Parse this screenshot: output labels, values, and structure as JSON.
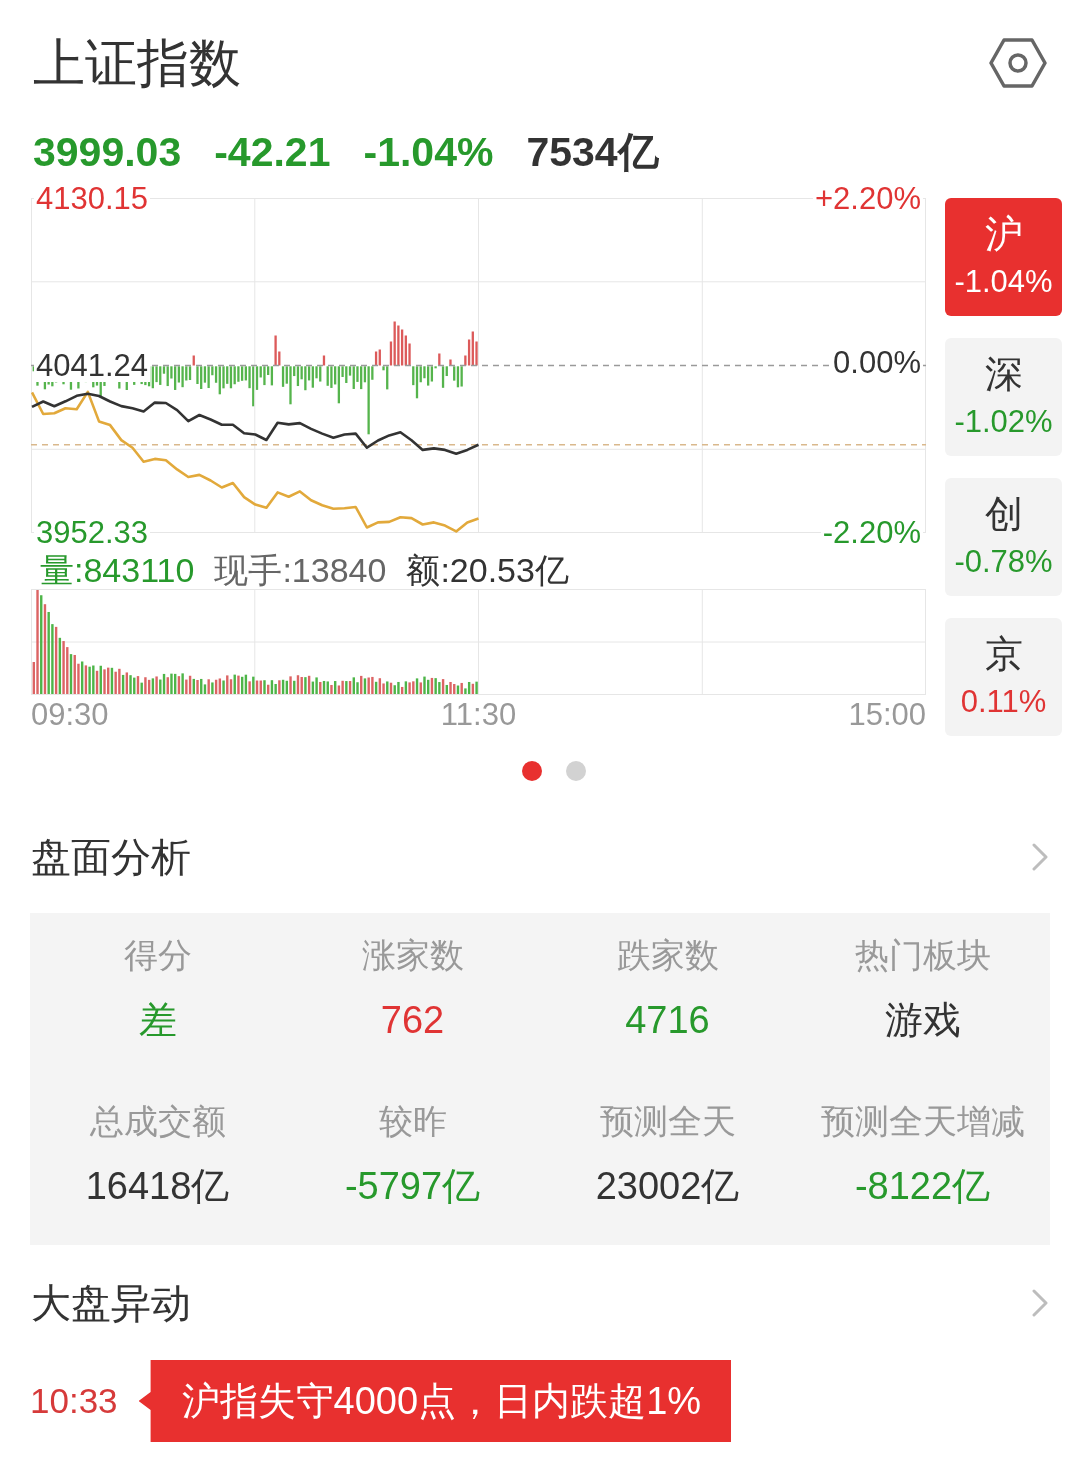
{
  "header": {
    "title": "上证指数"
  },
  "quote": [
    {
      "text": "3999.03",
      "color": "#27992c"
    },
    {
      "text": "-42.21",
      "color": "#27992c"
    },
    {
      "text": "-1.04%",
      "color": "#27992c"
    },
    {
      "text": "7534亿",
      "color": "#333333"
    }
  ],
  "chart": {
    "chart_data": {
      "type": "line",
      "categories": [
        null,
        null,
        null,
        null,
        null,
        null,
        null,
        null,
        null,
        null,
        null,
        null,
        null,
        null,
        null,
        null,
        null,
        null,
        null,
        null,
        null,
        null,
        null,
        null,
        null,
        null,
        null,
        null,
        null,
        null,
        null,
        null,
        null,
        null,
        null,
        null,
        null,
        null,
        null,
        null,
        null,
        null,
        null,
        null,
        null,
        null,
        null,
        null,
        null,
        null,
        null,
        null,
        null,
        null,
        null,
        null,
        null,
        null,
        null,
        null,
        null,
        null,
        null,
        null,
        null,
        null,
        null,
        null,
        null,
        null,
        null,
        null,
        null,
        null,
        null,
        null,
        null,
        null,
        null,
        null,
        null
      ],
      "ylim": [
        3952.33,
        4130.15
      ],
      "yticks": [
        {
          "value": 4130.15,
          "label": "4130.15"
        },
        {
          "value": 4041.24,
          "label": "4041.24"
        },
        {
          "value": 3952.33,
          "label": "3952.33"
        }
      ],
      "ref_lines": [
        {
          "axis": "y",
          "value": 4041.24,
          "color": "#9a9a9a"
        },
        {
          "axis": "y",
          "value": 3999.03,
          "color": "#d9b88c"
        }
      ],
      "series": [
        {
          "color": "#333333",
          "values": [
            4019.2,
            4022.1,
            4019.5,
            4022.2,
            4025.1,
            4026.2,
            4025.0,
            4022.1,
            4019.6,
            4018.5,
            4016.8,
            4021.5,
            4021.3,
            4017.5,
            4011.6,
            4014.9,
            4012.5,
            4009.7,
            4009.7,
            4005.2,
            4004.5,
            4001.6,
            4010.8,
            4009.9,
            4010.6,
            4007.5,
            4005.0,
            4002.8,
            4004.5,
            4005.0,
            3997.5,
            4001.3,
            4004.0,
            4005.7,
            4001.4,
            3996.3,
            3997.1,
            3996.3,
            3994.3,
            3996.3,
            3999.0,
            null,
            null,
            null,
            null,
            null,
            null,
            null,
            null,
            null,
            null,
            null,
            null,
            null,
            null,
            null,
            null,
            null,
            null,
            null,
            null,
            null,
            null,
            null,
            null,
            null,
            null,
            null,
            null,
            null,
            null,
            null,
            null,
            null,
            null,
            null,
            null,
            null,
            null,
            null,
            null
          ]
        },
        {
          "color": "#e2a93b",
          "values": [
            4026.9,
            4015.4,
            4015.8,
            4018.5,
            4018.0,
            4027.2,
            4011.5,
            4009.5,
            4001.5,
            3997.4,
            3990.0,
            3991.5,
            3990.8,
            3985.9,
            3981.9,
            3983.0,
            3980.0,
            3976.3,
            3978.7,
            3971.2,
            3967.2,
            3965.5,
            3973.7,
            3971.4,
            3974.2,
            3969.5,
            3966.8,
            3965.0,
            3965.2,
            3965.9,
            3955.0,
            3957.7,
            3958.0,
            3960.5,
            3960.0,
            3956.6,
            3957.7,
            3956.0,
            3952.9,
            3957.7,
            3959.8,
            null,
            null,
            null,
            null,
            null,
            null,
            null,
            null,
            null,
            null,
            null,
            null,
            null,
            null,
            null,
            null,
            null,
            null,
            null,
            null,
            null,
            null,
            null,
            null,
            null,
            null,
            null,
            null,
            null,
            null,
            null,
            null,
            null,
            null,
            null,
            null,
            null,
            null,
            null,
            null
          ]
        }
      ]
    },
    "right_labels": [
      {
        "text": "+2.20%",
        "color": "#e03434"
      },
      {
        "text": "0.00%",
        "color": "#333333"
      },
      {
        "text": "-2.20%",
        "color": "#27992c"
      }
    ],
    "volume_info": [
      {
        "kind": "volume",
        "text": "量:843110"
      },
      {
        "kind": "last_hand",
        "text": "现手:13840"
      },
      {
        "kind": "amount",
        "text": "额:20.53亿"
      }
    ],
    "time_labels": [
      "09:30",
      "11:30",
      "15:00"
    ]
  },
  "markets": [
    {
      "label": "沪",
      "change": "-1.04%",
      "selected": true
    },
    {
      "label": "深",
      "change": "-1.02%",
      "color": "#27992c",
      "selected": false
    },
    {
      "label": "创",
      "change": "-0.78%",
      "color": "#27992c",
      "selected": false
    },
    {
      "label": "京",
      "change": "0.11%",
      "color": "#e03434",
      "selected": false
    }
  ],
  "pager": [
    {
      "selected": true
    },
    {
      "selected": false
    }
  ],
  "analysis": {
    "title": "盘面分析",
    "stats": [
      {
        "label": "得分",
        "value": "差",
        "color": "#27992c"
      },
      {
        "label": "涨家数",
        "value": "762",
        "color": "#e03434"
      },
      {
        "label": "跌家数",
        "value": "4716",
        "color": "#27992c"
      },
      {
        "label": "热门板块",
        "value": "游戏",
        "color": "#333333"
      },
      {
        "label": "总成交额",
        "value": "16418亿",
        "color": "#333333"
      },
      {
        "label": "较昨",
        "value": "-5797亿",
        "color": "#27992c"
      },
      {
        "label": "预测全天",
        "value": "23002亿",
        "color": "#333333"
      },
      {
        "label": "预测全天增减",
        "value": "-8122亿",
        "color": "#27992c"
      }
    ]
  },
  "movements": {
    "title": "大盘异动",
    "events": [
      {
        "time": "10:33",
        "text": "沪指失守4000点，日内跌超1%"
      }
    ]
  }
}
